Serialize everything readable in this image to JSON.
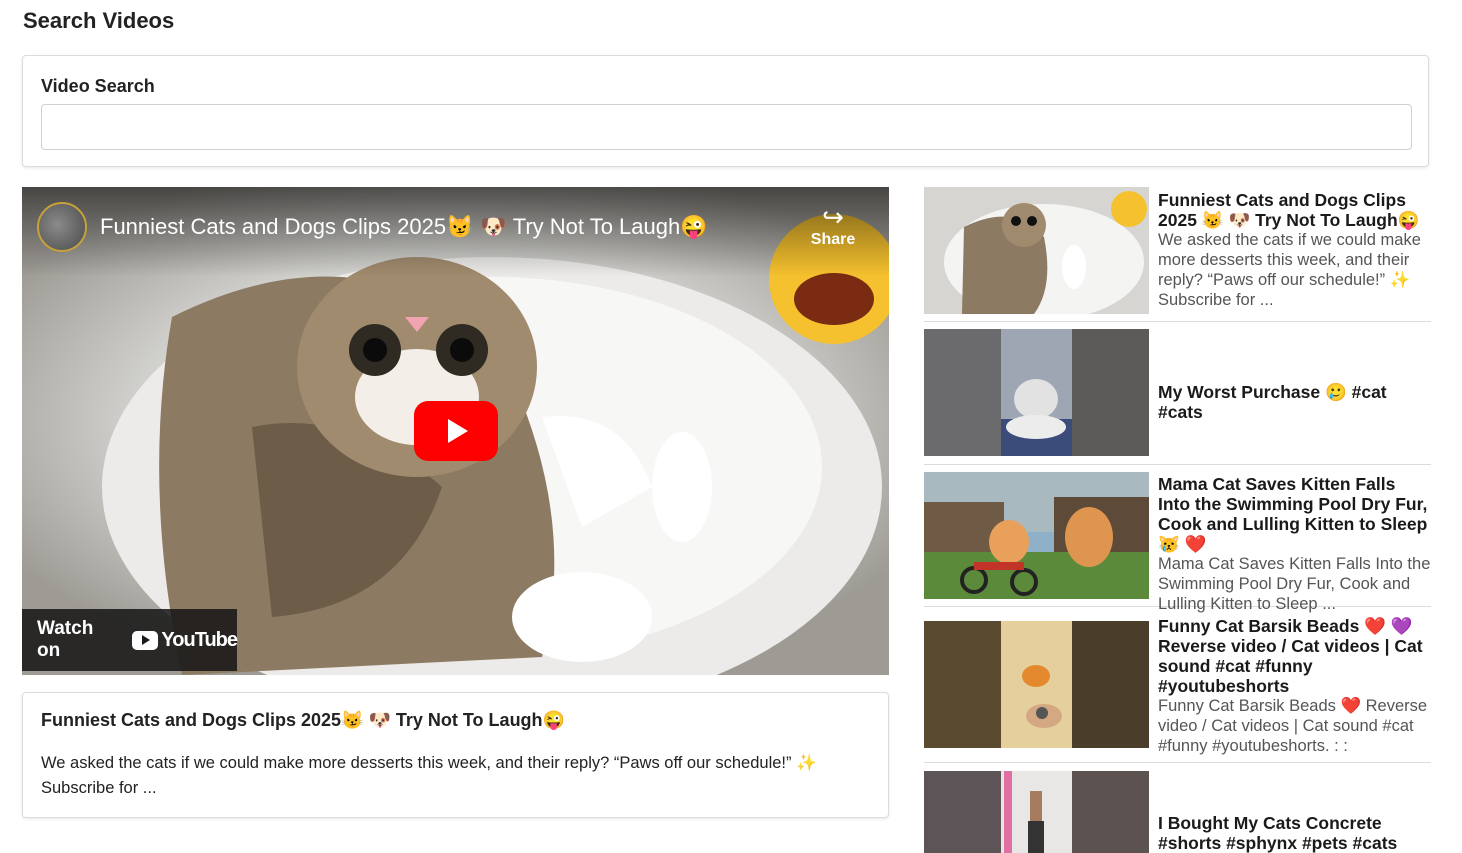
{
  "page": {
    "title": "Search Videos"
  },
  "search": {
    "label": "Video Search",
    "value": "",
    "placeholder": ""
  },
  "player": {
    "title": "Funniest Cats and Dogs Clips 2025😼 🐶 Try Not To Laugh😜",
    "share_label": "Share",
    "watch_on_label": "Watch on",
    "youtube_label": "YouTube"
  },
  "selected_video": {
    "title": "Funniest Cats and Dogs Clips 2025😼 🐶 Try Not To Laugh😜",
    "description": "We asked the cats if we could make more desserts this week, and their reply? “Paws off our schedule!” ✨ Subscribe for ..."
  },
  "results": [
    {
      "title": "Funniest Cats and Dogs Clips 2025 😼 🐶 Try Not To Laugh😜",
      "description": "We asked the cats if we could make more desserts this week, and their reply? “Paws off our schedule!” ✨ Subscribe for ..."
    },
    {
      "title": "My Worst Purchase 🥲 #cat #cats",
      "description": ""
    },
    {
      "title": "Mama Cat Saves Kitten Falls Into the Swimming Pool Dry Fur, Cook and Lulling Kitten to Sleep 😿 ❤️",
      "description": "Mama Cat Saves Kitten Falls Into the Swimming Pool Dry Fur, Cook and Lulling Kitten to Sleep ..."
    },
    {
      "title": "Funny Cat Barsik Beads ❤️ 💜 Reverse video / Cat videos | Cat sound #cat #funny #youtubeshorts",
      "description": "Funny Cat Barsik Beads ❤️ Reverse video / Cat videos | Cat sound #cat #funny #youtubeshorts. : :"
    },
    {
      "title": "I Bought My Cats Concrete #shorts #sphynx #pets #cats",
      "description": ""
    }
  ]
}
